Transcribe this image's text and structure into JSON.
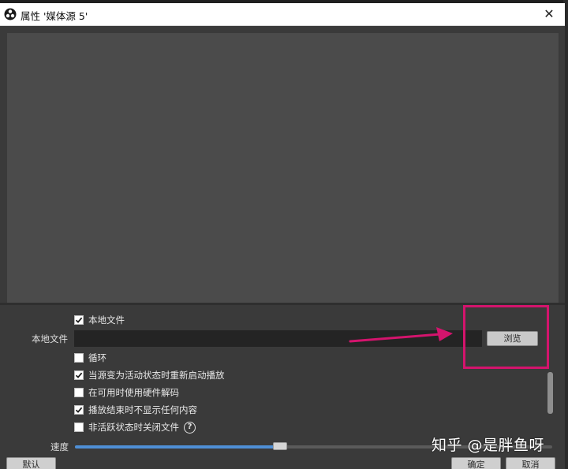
{
  "window": {
    "title": "属性 '媒体源 5'",
    "close_icon": "close-icon",
    "app_icon": "obs-logo-icon"
  },
  "form": {
    "local_file_checkbox": {
      "label": "本地文件",
      "checked": true
    },
    "file_field": {
      "label": "本地文件",
      "value": "",
      "browse_label": "浏览"
    },
    "options": [
      {
        "label": "循环",
        "checked": false
      },
      {
        "label": "当源变为活动状态时重新启动播放",
        "checked": true
      },
      {
        "label": "在可用时使用硬件解码",
        "checked": false
      },
      {
        "label": "播放结束时不显示任何内容",
        "checked": true
      },
      {
        "label": "非活跃状态时关闭文件",
        "checked": false,
        "help_icon": "help-circle-icon"
      }
    ],
    "speed": {
      "label": "速度",
      "value": 0.43
    }
  },
  "buttons": {
    "defaults": "默认",
    "ok": "确定",
    "cancel": "取消"
  },
  "annotation": {
    "highlight_color": "#d4146d",
    "arrow_color": "#d4146d"
  },
  "watermark": "知乎 @是胖鱼呀",
  "colors": {
    "preview_bg": "#4b4b4b",
    "dialog_bg": "#3a3a3a",
    "slider_fill": "#4f8fd6"
  }
}
